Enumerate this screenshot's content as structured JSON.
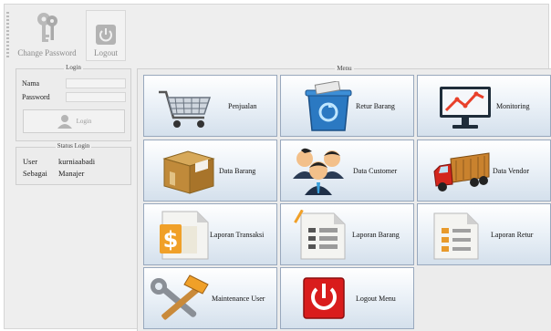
{
  "toolbar": {
    "change_password_label": "Change Password",
    "logout_label": "Logout"
  },
  "login": {
    "title": "Login",
    "nama_label": "Nama",
    "password_label": "Password",
    "nama_value": "",
    "password_value": "",
    "button_label": "Login"
  },
  "status": {
    "title": "Status Login",
    "user_label": "User",
    "user_value": "kurniaabadi",
    "role_label": "Sebagai",
    "role_value": "Manajer"
  },
  "menu": {
    "title": "Menu",
    "items": [
      {
        "label": "Penjualan",
        "icon": "shopping-cart-icon"
      },
      {
        "label": "Retur Barang",
        "icon": "recycle-bin-icon"
      },
      {
        "label": "Monitoring",
        "icon": "monitor-chart-icon"
      },
      {
        "label": "Data Barang",
        "icon": "box-icon"
      },
      {
        "label": "Data Customer",
        "icon": "users-icon"
      },
      {
        "label": "Data Vendor",
        "icon": "truck-icon"
      },
      {
        "label": "Laporan Transaksi",
        "icon": "dollar-report-icon"
      },
      {
        "label": "Laporan Barang",
        "icon": "document-report-icon"
      },
      {
        "label": "Laporan Retur",
        "icon": "return-report-icon"
      },
      {
        "label": "Maintenance User",
        "icon": "tools-icon"
      },
      {
        "label": "Logout Menu",
        "icon": "power-icon"
      }
    ]
  },
  "colors": {
    "button_border": "#98a8bd",
    "button_gradient_bottom": "#d4e0ec",
    "logout_red": "#d91c1c"
  }
}
